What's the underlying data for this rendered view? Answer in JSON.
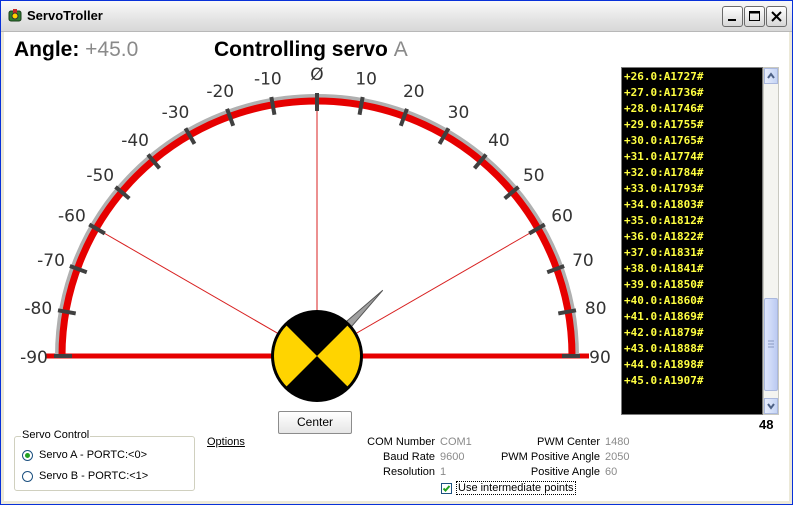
{
  "window": {
    "title": "ServoTroller",
    "icon": "servo-app-icon",
    "controls": [
      "minimize-icon",
      "maximize-icon",
      "close-icon"
    ]
  },
  "header": {
    "angle_label": "Angle:",
    "angle_value": "+45.0",
    "controlling_label": "Controlling servo",
    "controlling_value": "A"
  },
  "gauge": {
    "min": -90,
    "max": 90,
    "tick_step": 10,
    "center_label": "Ø",
    "current_angle": 45,
    "positive_limit": 60,
    "negative_limit": -60,
    "colors": {
      "arc": "#e60000",
      "ticks": "#404040",
      "limit_lines": "#d82020",
      "needle": "#a0a0a0",
      "indicator_yellow": "#ffd400",
      "indicator_black": "#000000"
    }
  },
  "center_button": "Center",
  "log": {
    "lines": [
      "+26.0:A1727#",
      "+27.0:A1736#",
      "+28.0:A1746#",
      "+29.0:A1755#",
      "+30.0:A1765#",
      "+31.0:A1774#",
      "+32.0:A1784#",
      "+33.0:A1793#",
      "+34.0:A1803#",
      "+35.0:A1812#",
      "+36.0:A1822#",
      "+37.0:A1831#",
      "+38.0:A1841#",
      "+39.0:A1850#",
      "+40.0:A1860#",
      "+41.0:A1869#",
      "+42.0:A1879#",
      "+43.0:A1888#",
      "+44.0:A1898#",
      "+45.0:A1907#"
    ],
    "count": "48",
    "colors": {
      "background": "#000000",
      "text": "#ffff40"
    }
  },
  "servo_control": {
    "title": "Servo Control",
    "options": [
      {
        "label": "Servo A - PORTC:<0>",
        "selected": true
      },
      {
        "label": "Servo B - PORTC:<1>",
        "selected": false
      }
    ]
  },
  "options_link": "Options",
  "settings": {
    "com_number_label": "COM Number",
    "com_number": "COM1",
    "baud_rate_label": "Baud Rate",
    "baud_rate": "9600",
    "resolution_label": "Resolution",
    "resolution": "1",
    "pwm_center_label": "PWM Center",
    "pwm_center": "1480",
    "pwm_positive_label": "PWM Positive Angle",
    "pwm_positive": "2050",
    "positive_angle_label": "Positive Angle",
    "positive_angle": "60"
  },
  "intermediate_points": {
    "label": "Use intermediate points",
    "checked": true
  }
}
